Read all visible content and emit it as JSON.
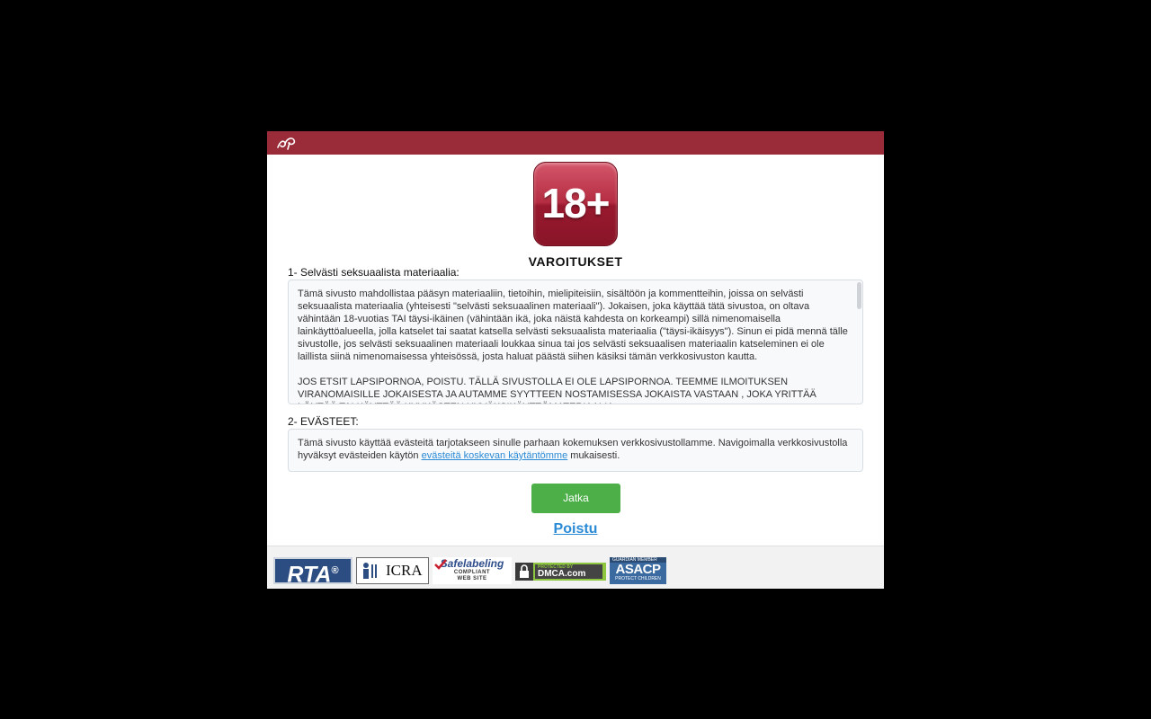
{
  "badge": {
    "text": "18+"
  },
  "warnings_title": "VAROITUKSET",
  "section1": {
    "label": "1- Selvästi seksuaalista materiaalia:",
    "paragraphs": [
      "Tämä sivusto mahdollistaa pääsyn materiaaliin, tietoihin, mielipiteisiin, sisältöön ja kommentteihin, joissa on selvästi seksuaalista materiaalia (yhteisesti \"selvästi seksuaalinen materiaali\"). Jokaisen, joka käyttää tätä sivustoa, on oltava vähintään 18-vuotias TAI täysi-ikäinen (vähintään ikä, joka näistä kahdesta on korkeampi) sillä nimenomaisella lainkäyttöalueella, jolla katselet tai saatat katsella selvästi seksuaalista materiaalia (\"täysi-ikäisyys\"). Sinun ei pidä mennä tälle sivustolle, jos selvästi seksuaalinen materiaali loukkaa sinua tai jos selvästi seksuaalisen materiaalin katseleminen ei ole laillista siinä nimenomaisessa yhteisössä, josta haluat päästä siihen käsiksi tämän verkkosivuston kautta.",
      "JOS ETSIT LAPSIPORNOA, POISTU. TÄLLÄ SIVUSTOLLA EI OLE LAPSIPORNOA. TEEMME ILMOITUKSEN VIRANOMAISILLE JOKAISESTA JA AUTAMME SYYTTEEN NOSTAMISESSA JOKAISTA VASTAAN , JOKA YRITTÄÄ LÖYTÄÄ TAI KÄYTTÄÄ KYYKÄSTEN HYVÄKSIKÄYTTÖMATERIAALIA."
    ]
  },
  "section2": {
    "label": "2- EVÄSTEET:",
    "text_before": "Tämä sivusto käyttää evästeitä tarjotakseen sinulle parhaan kokemuksen verkkosivustollamme. Navigoimalla verkkosivustolla hyväksyt evästeiden käytön ",
    "link": "evästeitä koskevan käytäntömme",
    "text_after": " mukaisesti."
  },
  "buttons": {
    "continue": "Jatka",
    "exit": "Poistu"
  },
  "footer_logos": {
    "rta": "RTA",
    "rta_reg": "®",
    "icra": "ICRA",
    "safelabeling": "Safelabeling",
    "safelabeling_sub1": "COMPLIANT",
    "safelabeling_sub2": "WEB SITE",
    "dmca_small": "PROTECTED BY",
    "dmca": "DMCA.com",
    "asacp_top": "GUARDIAN MEMBER",
    "asacp": "ASACP",
    "asacp_bottom": "PROTECT CHILDREN"
  },
  "colors": {
    "header": "#9a2c3a",
    "continue_button": "#4caf48",
    "link": "#2a8ad6"
  },
  "icons": [
    "site-logo-icon",
    "icra-icon",
    "lock-icon",
    "checkmark-icon"
  ]
}
